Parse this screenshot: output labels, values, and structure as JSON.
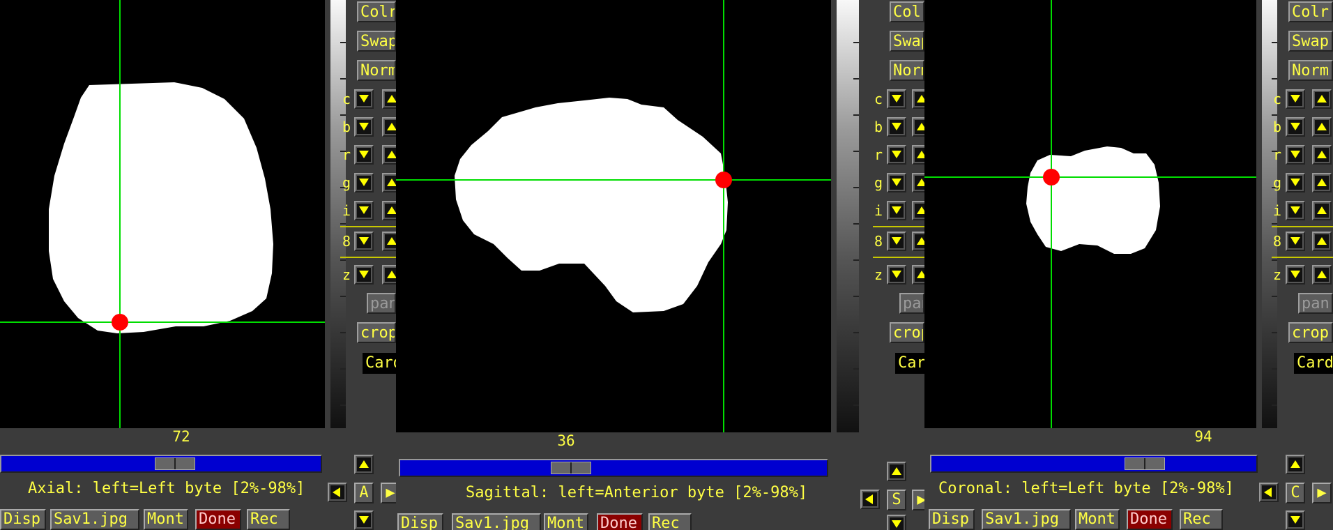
{
  "colors": {
    "accent": "#ffff44",
    "slider": "#0000d0",
    "crosshair": "#00dd00",
    "marker": "#ff0000",
    "done_button": "#8a0000"
  },
  "viewers": [
    {
      "name": "axial",
      "slice_number": "72",
      "slider_position": 0.55,
      "status": "Axial: left=Left byte [2%-98%]",
      "orient_button": "A",
      "buttons": {
        "colr": "Colr",
        "swap": "Swap",
        "norm": "Norm",
        "pan": "pan",
        "crop": "crop",
        "card": "Card"
      },
      "labels": [
        "c",
        "b",
        "r",
        "g",
        "i",
        "8",
        "z"
      ],
      "bottom_buttons": {
        "disp": "Disp",
        "save": "Sav1.jpg",
        "mont": "Mont",
        "done": "Done",
        "rec": "Rec"
      }
    },
    {
      "name": "sagittal",
      "slice_number": "36",
      "slider_position": 0.39,
      "status": "Sagittal: left=Anterior byte [2%-98%]",
      "orient_button": "S",
      "buttons": {
        "colr": "Colr",
        "swap": "Swap",
        "norm": "Norm",
        "pan": "pan",
        "crop": "crop",
        "card": "Card"
      },
      "labels": [
        "c",
        "b",
        "r",
        "g",
        "i",
        "8",
        "z"
      ],
      "bottom_buttons": {
        "disp": "Disp",
        "save": "Sav1.jpg",
        "mont": "Mont",
        "done": "Done",
        "rec": "Rec"
      }
    },
    {
      "name": "coronal",
      "slice_number": "94",
      "slider_position": 0.68,
      "status": "Coronal: left=Left byte [2%-98%]",
      "orient_button": "C",
      "buttons": {
        "colr": "Colr",
        "swap": "Swap",
        "norm": "Norm",
        "pan": "pan",
        "crop": "crop",
        "card": "Card"
      },
      "labels": [
        "c",
        "b",
        "r",
        "g",
        "i",
        "8",
        "z"
      ],
      "bottom_buttons": {
        "disp": "Disp",
        "save": "Sav1.jpg",
        "mont": "Mont",
        "done": "Done",
        "rec": "Rec"
      }
    }
  ]
}
